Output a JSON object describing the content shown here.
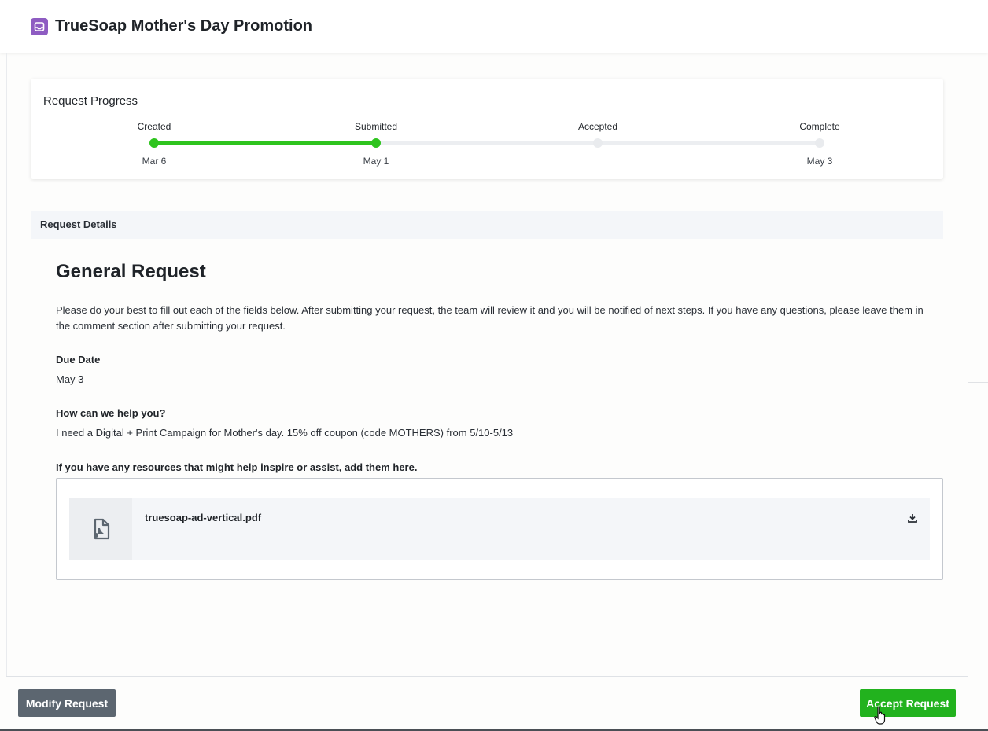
{
  "header": {
    "title": "TrueSoap Mother's Day Promotion",
    "icon": "inbox-icon",
    "icon_color": "#8e5cc2"
  },
  "progress": {
    "title": "Request Progress",
    "accent_color": "#2ec41e",
    "completed_fraction": 0.333,
    "steps": [
      {
        "label": "Created",
        "date": "Mar 6",
        "done": true
      },
      {
        "label": "Submitted",
        "date": "May 1",
        "done": true
      },
      {
        "label": "Accepted",
        "date": "",
        "done": false
      },
      {
        "label": "Complete",
        "date": "May 3",
        "done": false
      }
    ]
  },
  "details": {
    "section_label": "Request Details",
    "form_title": "General Request",
    "intro": "Please do your best to fill out each of the fields below. After submitting your request, the team will review it and you will be notified of next steps. If you have any questions, please leave them in the comment section after submitting your request.",
    "fields": [
      {
        "label": "Due Date",
        "value": "May 3"
      },
      {
        "label": "How can we help you?",
        "value": "I need a Digital + Print Campaign for Mother's day. 15% off coupon (code MOTHERS) from 5/10-5/13"
      },
      {
        "label": "If you have any resources that might help inspire or assist, add them here.",
        "value": ""
      }
    ],
    "attachment": {
      "file_name": "truesoap-ad-vertical.pdf",
      "file_icon": "pdf-file-icon",
      "action_icon": "download-icon"
    }
  },
  "footer": {
    "modify_label": "Modify Request",
    "accept_label": "Accept Request",
    "modify_color": "#5c6670",
    "accept_color": "#22b21e"
  }
}
